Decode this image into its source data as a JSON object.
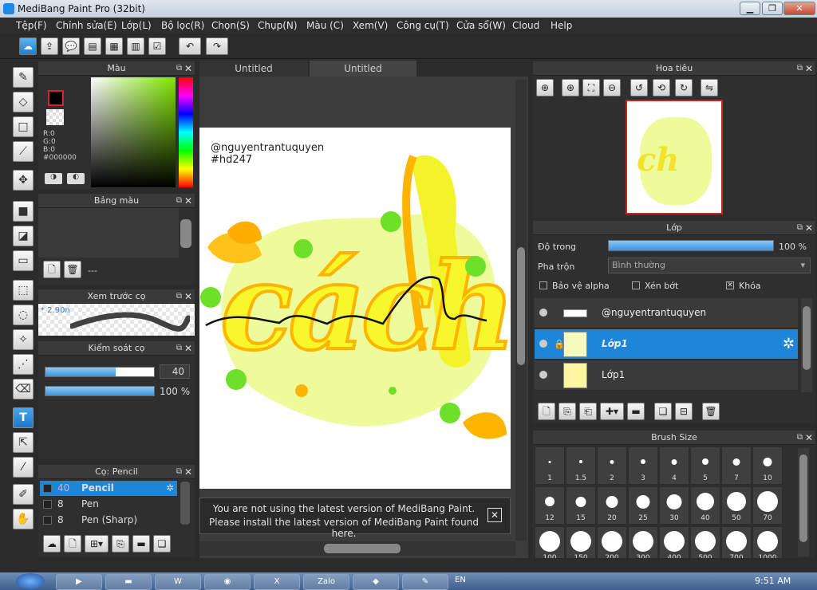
{
  "window": {
    "title": "MediBang Paint Pro (32bit)",
    "min": "▁",
    "max": "❐",
    "close": "✕"
  },
  "menu": [
    "Tệp(F)",
    "Chỉnh sửa(E)",
    "Lớp(L)",
    "Bộ lọc(R)",
    "Chọn(S)",
    "Chụp(N)",
    "Màu (C)",
    "Xem(V)",
    "Công cụ(T)",
    "Cửa sổ(W)",
    "Cloud",
    "Help"
  ],
  "panels": {
    "color": {
      "title": "Màu",
      "r": "R:0",
      "g": "G:0",
      "b": "B:0",
      "hex": "#000000"
    },
    "palette": {
      "title": "Bảng màu",
      "value": "---"
    },
    "brush_preview": {
      "title": "Xem trước cọ",
      "size": "* 2.90n"
    },
    "control": {
      "title": "Kiểm soát cọ",
      "size_value": "40",
      "opacity_value": "100 %",
      "size_fraction": 0.65,
      "opacity_fraction": 1.0
    },
    "brush": {
      "title": "Cọ: Pencil",
      "items": [
        {
          "size": "40",
          "name": "Pencil"
        },
        {
          "size": "8",
          "name": "Pen"
        },
        {
          "size": "8",
          "name": "Pen (Sharp)"
        }
      ]
    },
    "navigator": {
      "title": "Hoa tiêu"
    },
    "layer": {
      "title": "Lớp",
      "opacity_label": "Độ trong",
      "opacity_value": "100 %",
      "opacity_fraction": 1.0,
      "blend_label": "Pha trộn",
      "blend_value": "Bình thường",
      "protect_alpha": "Bảo vệ alpha",
      "clipping": "Xén bớt",
      "lock": "Khóa",
      "layers": [
        "@nguyentrantuquyen",
        "Lớp1",
        "Lớp1"
      ]
    },
    "brush_size": {
      "title": "Brush Size",
      "sizes": [
        "1",
        "1.5",
        "2",
        "3",
        "4",
        "5",
        "7",
        "10",
        "12",
        "15",
        "20",
        "25",
        "30",
        "40",
        "50",
        "70",
        "100",
        "150",
        "200",
        "300",
        "400",
        "500",
        "700",
        "1000"
      ]
    }
  },
  "tabs": [
    "Untitled",
    "Untitled"
  ],
  "canvas": {
    "credit1": "@nguyentrantuquyen",
    "credit2": "#hd247",
    "art_word": "cách"
  },
  "notice": {
    "line1": "You are not using the latest version of MediBang Paint.",
    "line2": "Please install the latest version of MediBang Paint found here.",
    "close": "✕"
  },
  "taskbar": {
    "lang": "EN",
    "time": "9:51 AM",
    "zalo": "Zalo"
  }
}
